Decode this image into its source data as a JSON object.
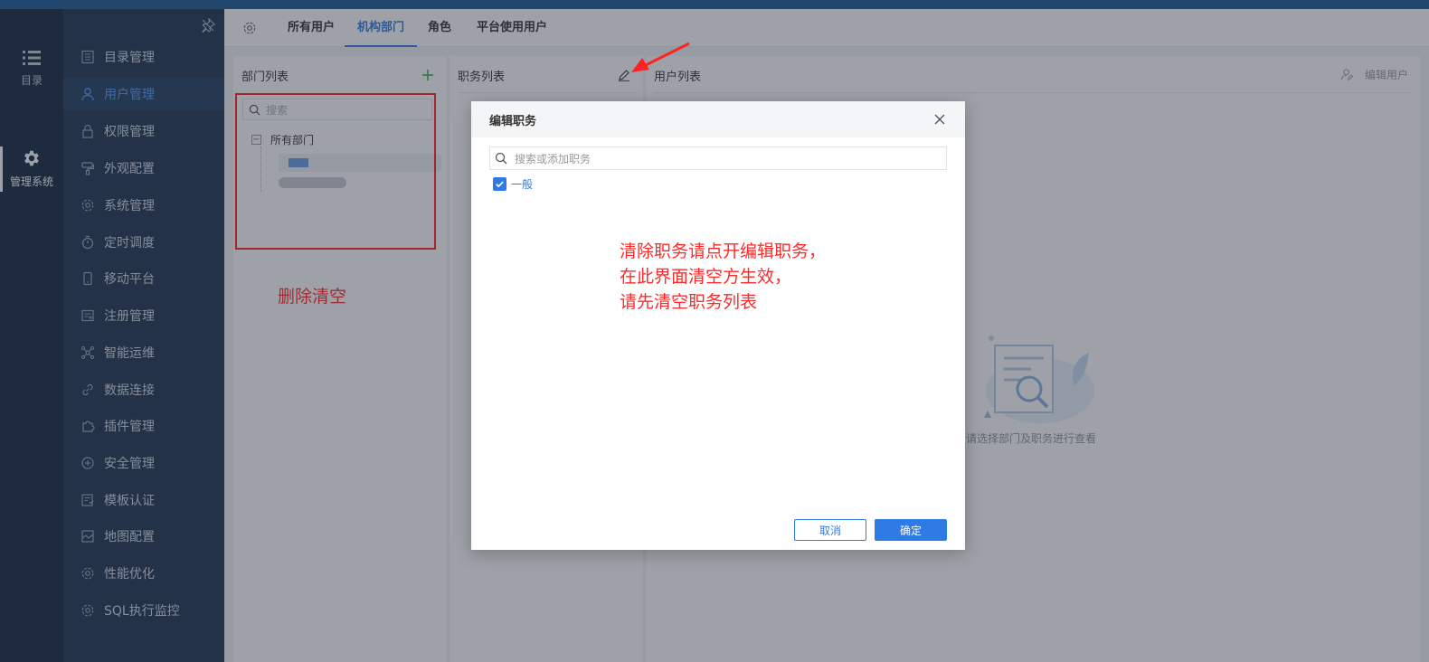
{
  "rail": {
    "items": [
      {
        "label": "目录"
      },
      {
        "label": "管理系统"
      }
    ]
  },
  "sidebar": {
    "items": [
      {
        "label": "目录管理"
      },
      {
        "label": "用户管理"
      },
      {
        "label": "权限管理"
      },
      {
        "label": "外观配置"
      },
      {
        "label": "系统管理"
      },
      {
        "label": "定时调度"
      },
      {
        "label": "移动平台"
      },
      {
        "label": "注册管理"
      },
      {
        "label": "智能运维"
      },
      {
        "label": "数据连接"
      },
      {
        "label": "插件管理"
      },
      {
        "label": "安全管理"
      },
      {
        "label": "模板认证"
      },
      {
        "label": "地图配置"
      },
      {
        "label": "性能优化"
      },
      {
        "label": "SQL执行监控"
      }
    ],
    "active_index": 1
  },
  "tabs": {
    "items": [
      {
        "label": "所有用户"
      },
      {
        "label": "机构部门"
      },
      {
        "label": "角色"
      },
      {
        "label": "平台使用用户"
      }
    ],
    "active_index": 1
  },
  "dept_panel": {
    "title": "部门列表",
    "search_placeholder": "搜索",
    "tree_root": "所有部门"
  },
  "post_panel": {
    "title": "职务列表"
  },
  "user_panel": {
    "title": "用户列表",
    "edit_user": "编辑用户",
    "empty_text": "请选择部门及职务进行查看"
  },
  "annotations": {
    "left_note": "删除清空",
    "center_note_lines": [
      "清除职务请点开编辑职务，",
      "在此界面清空方生效，",
      "请先清空职务列表"
    ]
  },
  "modal": {
    "title": "编辑职务",
    "search_placeholder": "搜索或添加职务",
    "options": [
      {
        "label": "一般",
        "checked": true
      }
    ],
    "cancel_label": "取消",
    "ok_label": "确定"
  },
  "colors": {
    "accent": "#2f7be5",
    "annotation_red": "#ff2222",
    "rail_bg": "#17263e",
    "sidebar_bg": "#20334f"
  }
}
